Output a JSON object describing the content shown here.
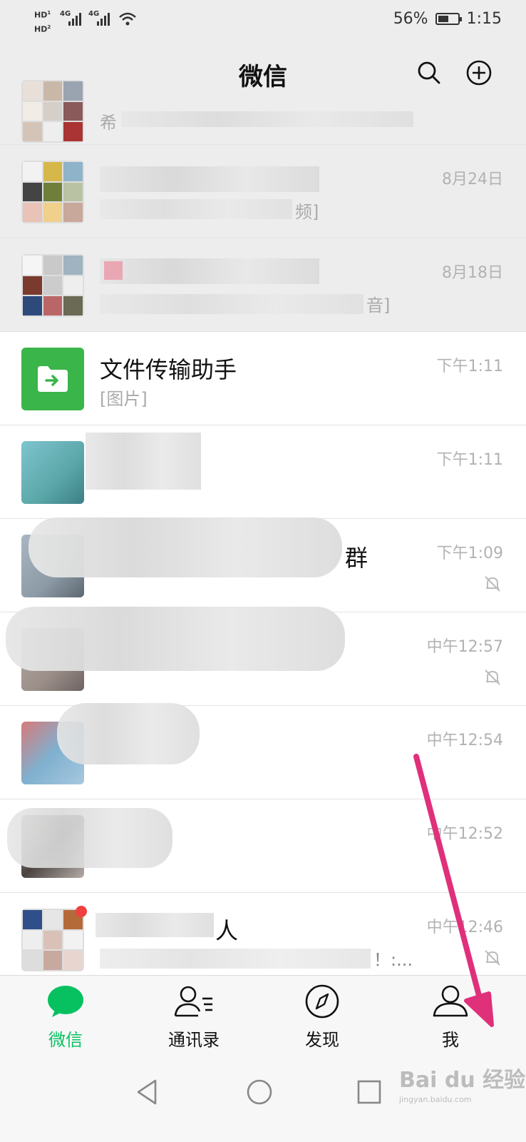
{
  "status_bar": {
    "hd1": "HD",
    "hd2": "HD",
    "net1": "4G",
    "net2": "4G",
    "battery_text": "56%",
    "battery_level": 0.56,
    "time": "1:15"
  },
  "header": {
    "title": "微信",
    "search_icon": "search-icon",
    "add_icon": "plus-circle-icon"
  },
  "chats": [
    {
      "name": "",
      "preview": "希",
      "time": "",
      "muted": false
    },
    {
      "name": "",
      "preview": "频]",
      "time": "8月24日",
      "muted": false
    },
    {
      "name": "",
      "preview": "音]",
      "time": "8月18日",
      "muted": false
    },
    {
      "name": "文件传输助手",
      "preview": "[图片]",
      "time": "下午1:11",
      "muted": false
    },
    {
      "name": "",
      "preview": "",
      "time": "下午1:11",
      "muted": false
    },
    {
      "name": "群",
      "preview": "",
      "time": "下午1:09",
      "muted": true
    },
    {
      "name": "",
      "preview": "",
      "time": "中午12:57",
      "muted": true
    },
    {
      "name": "",
      "preview": "",
      "time": "中午12:54",
      "muted": false
    },
    {
      "name": "",
      "preview": "",
      "time": "中午12:52",
      "muted": false
    },
    {
      "name": "人",
      "preview": "！:...",
      "time": "中午12:46",
      "muted": true
    }
  ],
  "tabs": [
    {
      "label": "微信",
      "icon": "chat-bubble-icon",
      "active": true
    },
    {
      "label": "通讯录",
      "icon": "contacts-icon",
      "active": false
    },
    {
      "label": "发现",
      "icon": "compass-icon",
      "active": false
    },
    {
      "label": "我",
      "icon": "person-icon",
      "active": false
    }
  ],
  "system_nav": [
    "back-icon",
    "home-icon",
    "recents-icon"
  ],
  "watermark": {
    "main": "Bai du 经验",
    "sub": "jingyan.baidu.com"
  },
  "colors": {
    "accent": "#07c160",
    "arrow": "#e0307a",
    "file_helper": "#3ab54a"
  }
}
